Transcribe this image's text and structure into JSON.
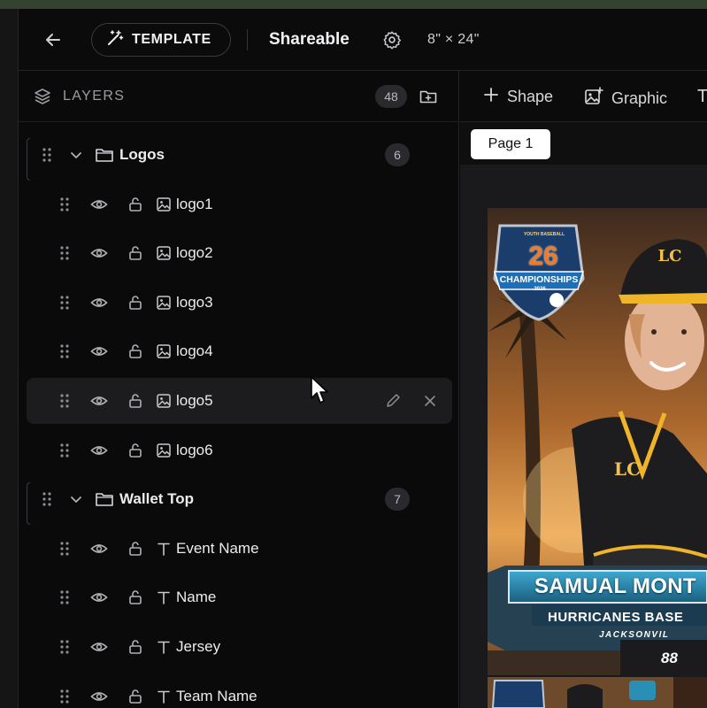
{
  "app": {
    "template_label": "TEMPLATE",
    "doc_title": "Shareable",
    "size_label": "8\" × 24\""
  },
  "layers": {
    "title": "LAYERS",
    "count": "48",
    "rows": [
      {
        "kind": "group",
        "name": "Logos",
        "count": "6"
      },
      {
        "kind": "image",
        "name": "logo1"
      },
      {
        "kind": "image",
        "name": "logo2"
      },
      {
        "kind": "image",
        "name": "logo3"
      },
      {
        "kind": "image",
        "name": "logo4"
      },
      {
        "kind": "image",
        "name": "logo5"
      },
      {
        "kind": "image",
        "name": "logo6"
      },
      {
        "kind": "group",
        "name": "Wallet Top",
        "count": "7"
      },
      {
        "kind": "text",
        "name": "Event Name"
      },
      {
        "kind": "text",
        "name": "Name"
      },
      {
        "kind": "text",
        "name": "Jersey"
      },
      {
        "kind": "text",
        "name": "Team Name"
      }
    ]
  },
  "toolbar": {
    "shape_label": "Shape",
    "graphic_label": "Graphic",
    "text_label": "T"
  },
  "canvas": {
    "page_tab": "Page 1",
    "card": {
      "badge_top": "YOUTH BASEBALL",
      "badge_number": "26",
      "badge_word": "CHAMPIONSHIPS",
      "badge_year": "2026",
      "cap_logo": "LC",
      "jersey_logo": "LC",
      "player_name": "SAMUAL MONT",
      "team_name": "HURRICANES BASE",
      "city": "JACKSONVIL",
      "jersey_number": "88"
    }
  },
  "colors": {
    "accent_gold": "#f0b429",
    "panel_bg": "#0a0a0b",
    "hover_row": "#1c1c1f",
    "nameplate_blue": "#2a8fb5"
  }
}
